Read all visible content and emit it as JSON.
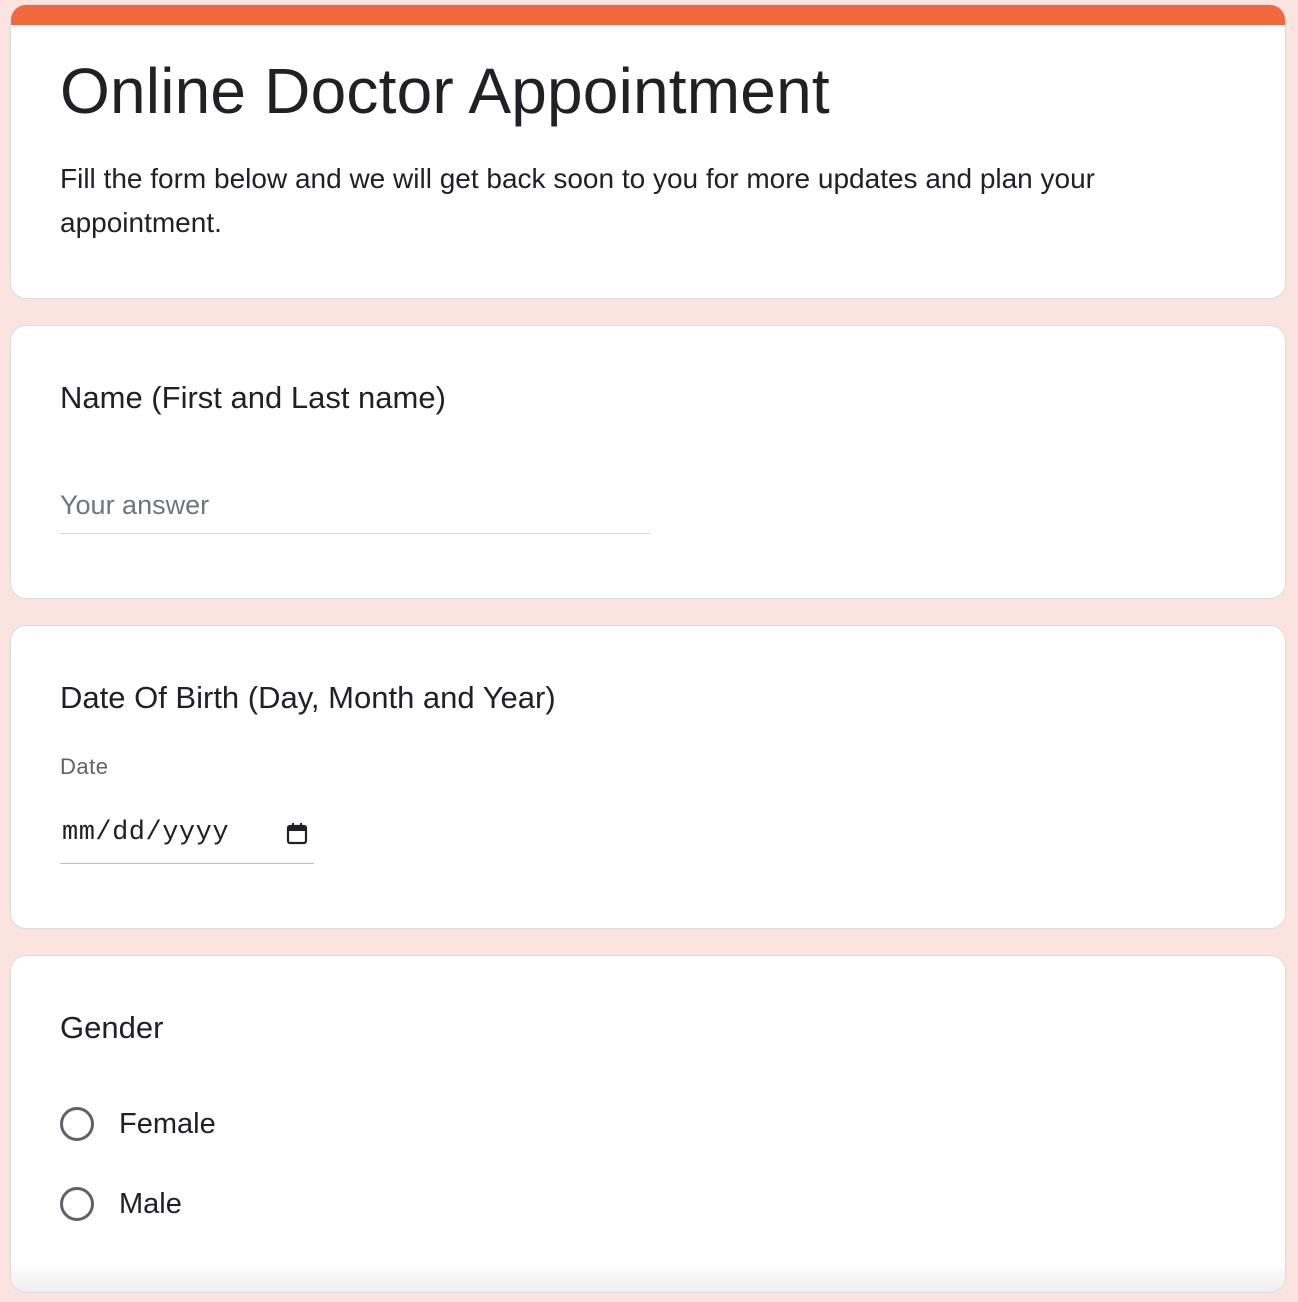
{
  "colors": {
    "accent": "#f0683b",
    "page_background": "#fbe4df",
    "card_background": "#ffffff",
    "text": "#202124"
  },
  "header": {
    "title": "Online Doctor Appointment",
    "description": "Fill the form below and we will get back soon to you for more updates and plan your appointment."
  },
  "questions": {
    "name": {
      "title": "Name (First and Last name)",
      "placeholder": "Your answer",
      "value": ""
    },
    "dob": {
      "title": "Date Of Birth (Day, Month and Year)",
      "caption": "Date",
      "value": "mm/dd/yyyy",
      "icon": "calendar-icon"
    },
    "gender": {
      "title": "Gender",
      "options": [
        "Female",
        "Male"
      ],
      "selected": null
    }
  }
}
